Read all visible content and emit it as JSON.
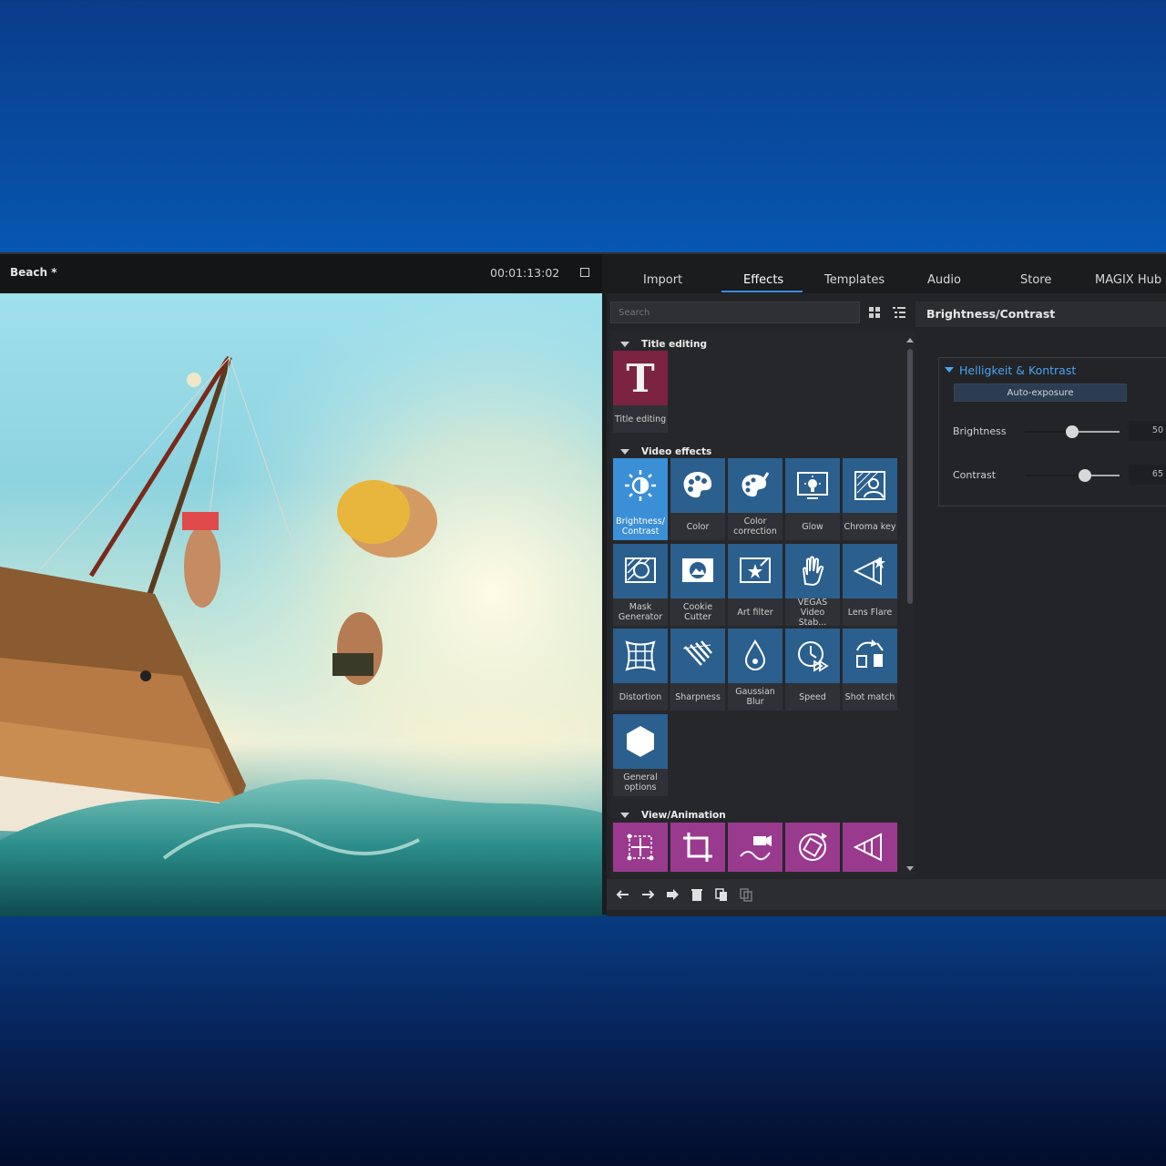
{
  "preview": {
    "project_title": "Beach *",
    "timecode": "00:01:13:02"
  },
  "tabs": [
    "Import",
    "Effects",
    "Templates",
    "Audio",
    "Store",
    "MAGIX Hub"
  ],
  "active_tab": "Effects",
  "search": {
    "placeholder": "Search"
  },
  "effect_header": "Brightness/Contrast",
  "sections": {
    "title_editing": {
      "label": "Title editing",
      "items": [
        "Title editing"
      ]
    },
    "video_effects": {
      "label": "Video effects",
      "items": [
        "Brightness/ Contrast",
        "Color",
        "Color correction",
        "Glow",
        "Chroma key",
        "Mask Generator",
        "Cookie Cutter",
        "Art filter",
        "VEGAS Video Stab...",
        "Lens Flare",
        "Distortion",
        "Sharpness",
        "Gaussian Blur",
        "Speed",
        "Shot match",
        "General options"
      ],
      "selected": "Brightness/ Contrast"
    },
    "view_animation": {
      "label": "View/Animation"
    }
  },
  "properties": {
    "group_title": "Helligkeit & Kontrast",
    "auto_button": "Auto-exposure",
    "brightness": {
      "label": "Brightness",
      "value": "50",
      "level": 0.5
    },
    "contrast": {
      "label": "Contrast",
      "value": "65",
      "level": 0.63
    }
  },
  "colors": {
    "accent": "#3a8ee0",
    "tile_blue": "#2b5f8e",
    "tile_selected": "#3b8fd6",
    "tile_maroon": "#7b2340",
    "tile_magenta": "#9a3a8e"
  }
}
